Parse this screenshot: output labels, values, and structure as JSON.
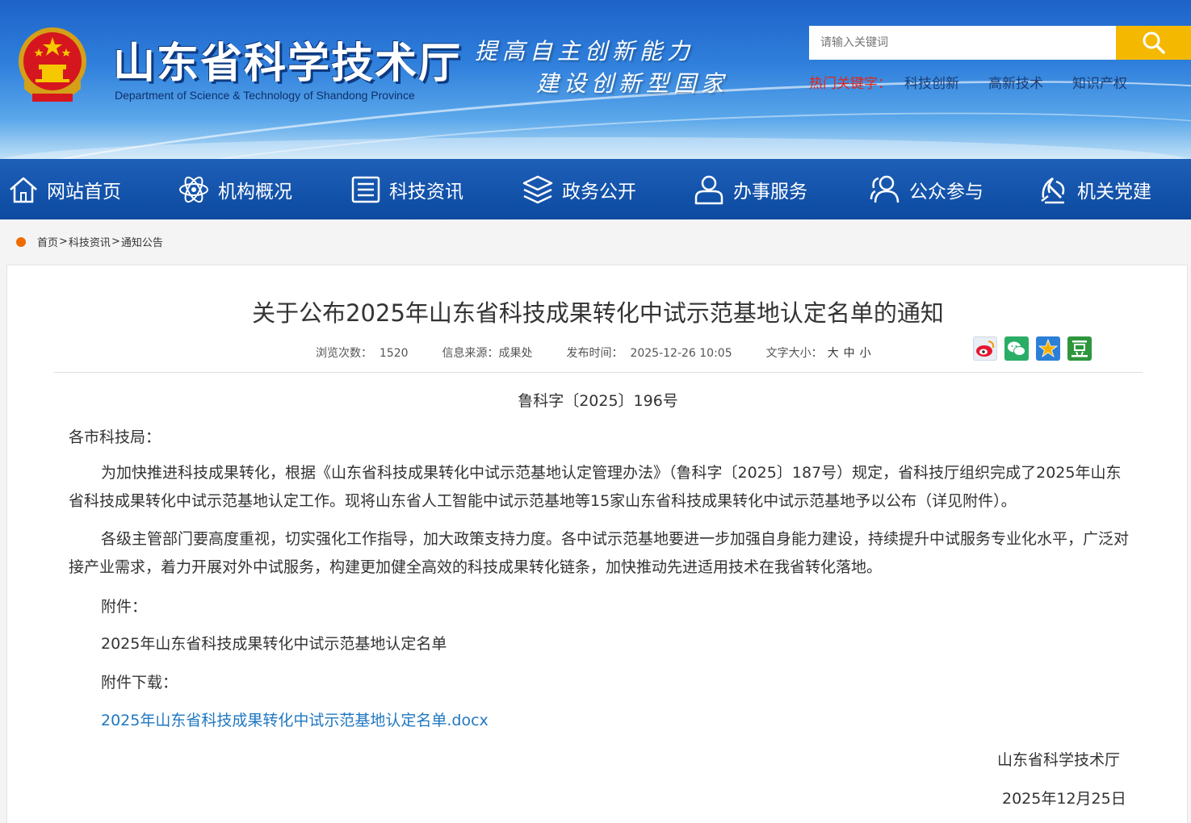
{
  "header": {
    "site_title": "山东省科学技术厅",
    "site_subtitle": "Department of Science & Technology of Shandong Province",
    "slogan_line1": "提高自主创新能力",
    "slogan_line2": "建设创新型国家",
    "search": {
      "placeholder": "请输入关键词"
    },
    "hot_label": "热门关键字：",
    "hot_keywords": [
      "科技创新",
      "高新技术",
      "知识产权"
    ]
  },
  "nav": [
    {
      "label": "网站首页",
      "icon": "home-icon"
    },
    {
      "label": "机构概况",
      "icon": "atom-icon"
    },
    {
      "label": "科技资讯",
      "icon": "news-list-icon"
    },
    {
      "label": "政务公开",
      "icon": "layers-icon"
    },
    {
      "label": "办事服务",
      "icon": "user-icon"
    },
    {
      "label": "公众参与",
      "icon": "users-icon"
    },
    {
      "label": "机关党建",
      "icon": "party-emblem-icon"
    }
  ],
  "breadcrumb": [
    "首页",
    "科技资讯",
    "通知公告"
  ],
  "article": {
    "title": "关于公布2025年山东省科技成果转化中试示范基地认定名单的通知",
    "views_label": "浏览次数：",
    "views": "1520",
    "source_label": "信息来源：",
    "source": "成果处",
    "time_label": "发布时间：",
    "time": "2025-12-26 10:05",
    "fontsize_label": "文字大小：",
    "fontsize_large": "大",
    "fontsize_medium": "中",
    "fontsize_small": "小",
    "doc_no": "鲁科字〔2025〕196号",
    "salutation": "各市科技局：",
    "paragraph1": "为加快推进科技成果转化，根据《山东省科技成果转化中试示范基地认定管理办法》（鲁科字〔2025〕187号）规定，省科技厅组织完成了2025年山东省科技成果转化中试示范基地认定工作。现将山东省人工智能中试示范基地等15家山东省科技成果转化中试示范基地予以公布（详见附件）。",
    "paragraph2": "各级主管部门要高度重视，切实强化工作指导，加大政策支持力度。各中试示范基地要进一步加强自身能力建设，持续提升中试服务专业化水平，广泛对接产业需求，着力开展对外中试服务，构建更加健全高效的科技成果转化链条，加快推动先进适用技术在我省转化落地。",
    "attachment_label": "附件：",
    "attachment_name": "2025年山东省科技成果转化中试示范基地认定名单",
    "download_label": "附件下载：",
    "download_link": "2025年山东省科技成果转化中试示范基地认定名单.docx",
    "signer": "山东省科学技术厅",
    "sign_date": "2025年12月25日"
  },
  "share": [
    {
      "icon": "weibo-icon",
      "color": "#e6162d"
    },
    {
      "icon": "wechat-icon",
      "color": "#2aae67"
    },
    {
      "icon": "qzone-star-icon",
      "color": "#f6b000"
    },
    {
      "icon": "douban-icon",
      "color": "#2e963d"
    }
  ],
  "colors": {
    "nav_bg": "#0c4aa0",
    "search_button": "#f5b800",
    "hot_label": "#e1251b",
    "link": "#1f78c1",
    "breadcrumb_dot": "#ef6c00"
  }
}
